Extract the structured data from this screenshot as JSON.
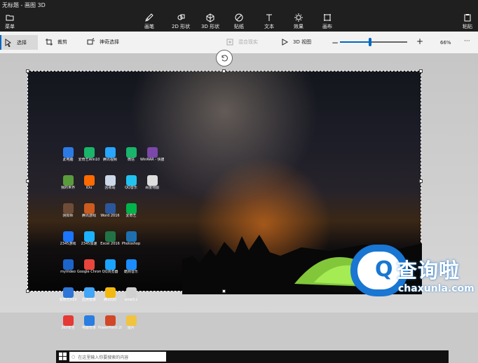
{
  "window": {
    "title": "无标题 - 画图 3D"
  },
  "ribbon": {
    "menu": "菜单",
    "brushes": "画笔",
    "shapes2d": "2D 形状",
    "shapes3d": "3D 形状",
    "stickers": "贴纸",
    "text": "文本",
    "effects": "效果",
    "canvas": "画布",
    "paste": "粘贴"
  },
  "toolbar": {
    "select": "选择",
    "crop": "裁剪",
    "magic_select": "神奇选择",
    "mixed_reality": "混合现实",
    "view3d": "3D 视图",
    "zoom_percent": "66%",
    "more": "···"
  },
  "zoom": {
    "value": 0.45
  },
  "desktop": {
    "icons": [
      {
        "label": "此电脑",
        "color": "#2c7be5"
      },
      {
        "label": "爱奇艺Win10",
        "color": "#18b56a"
      },
      {
        "label": "腾讯视频",
        "color": "#27a5ff"
      },
      {
        "label": "微信",
        "color": "#18b56a"
      },
      {
        "label": "WinRAR - 快捷方式",
        "color": "#7b47a8"
      },
      {
        "label": "我的世界",
        "color": "#5a9c3c"
      },
      {
        "label": "iDu",
        "color": "#ff6a00"
      },
      {
        "label": "回收站",
        "color": "#ccd7e8"
      },
      {
        "label": "QQ音乐",
        "color": "#22c2f0"
      },
      {
        "label": "百度地图",
        "color": "#dddddd"
      },
      {
        "label": "阴阳师",
        "color": "#6e4c37"
      },
      {
        "label": "腾讯游戏",
        "color": "#cc5b20"
      },
      {
        "label": "Word 2016",
        "color": "#2b579a"
      },
      {
        "label": "爱奇艺",
        "color": "#00b34a"
      },
      {
        "label": "",
        "color": "#000000"
      },
      {
        "label": "2345游戏",
        "color": "#1a75ff"
      },
      {
        "label": "2345加速",
        "color": "#1bb2ff"
      },
      {
        "label": "Excel 2016",
        "color": "#217346"
      },
      {
        "label": "Photoshop",
        "color": "#1d6fb0"
      },
      {
        "label": "",
        "color": "#000000"
      },
      {
        "label": "myVideo",
        "color": "#1c64c9"
      },
      {
        "label": "Google Chrome",
        "color": "#e8453c"
      },
      {
        "label": "QQ浏览器",
        "color": "#1aa3ff"
      },
      {
        "label": "酷狗音乐",
        "color": "#1a8cff"
      },
      {
        "label": "",
        "color": "#000000"
      },
      {
        "label": "爱奇艺X10",
        "color": "#2e75d6"
      },
      {
        "label": "应用管家",
        "color": "#42a5f5"
      },
      {
        "label": "腾讯QQ",
        "color": "#f2b80f"
      },
      {
        "label": "ame3.z",
        "color": "#d0d0d0"
      },
      {
        "label": "",
        "color": "#000000"
      },
      {
        "label": "360安全",
        "color": "#e53935"
      },
      {
        "label": "电脑管家",
        "color": "#2a7de1"
      },
      {
        "label": "PowerPoint 2016",
        "color": "#d24726"
      },
      {
        "label": "图片",
        "color": "#f0c341"
      },
      {
        "label": "",
        "color": "#000000"
      }
    ],
    "taskbar_search": "在这里输入你要搜索的内容"
  },
  "watermark": {
    "logo": "查询啦",
    "domain": "chaxunla.com",
    "accent": "#1976d2"
  }
}
